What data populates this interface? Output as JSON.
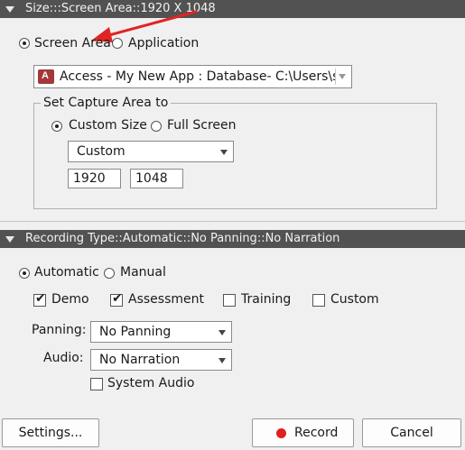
{
  "size_section": {
    "header": "Size:::Screen Area::1920 X 1048"
  },
  "capture_target": {
    "screen_area": "Screen Area",
    "application": "Application",
    "selected": "screen_area"
  },
  "app_select": {
    "value": "Access - My New App : Database- C:\\Users\\s..."
  },
  "capture_area": {
    "legend": "Set Capture Area to",
    "custom_size": "Custom Size",
    "full_screen": "Full Screen",
    "selected": "custom_size",
    "preset": "Custom",
    "width": "1920",
    "height": "1048"
  },
  "recording_section": {
    "header": "Recording Type::Automatic::No Panning::No Narration"
  },
  "recording_mode": {
    "automatic": "Automatic",
    "manual": "Manual",
    "selected": "automatic"
  },
  "modes": [
    {
      "label": "Demo",
      "checked": true
    },
    {
      "label": "Assessment",
      "checked": true
    },
    {
      "label": "Training",
      "checked": false
    },
    {
      "label": "Custom",
      "checked": false
    }
  ],
  "panning": {
    "label": "Panning:",
    "value": "No Panning"
  },
  "audio": {
    "label": "Audio:",
    "value": "No Narration"
  },
  "system_audio": {
    "label": "System Audio",
    "checked": false
  },
  "buttons": {
    "settings": "Settings...",
    "record": "Record",
    "cancel": "Cancel"
  },
  "colors": {
    "header_bg": "#525252",
    "record_dot": "#e02020",
    "annotation_arrow": "#e02424"
  }
}
